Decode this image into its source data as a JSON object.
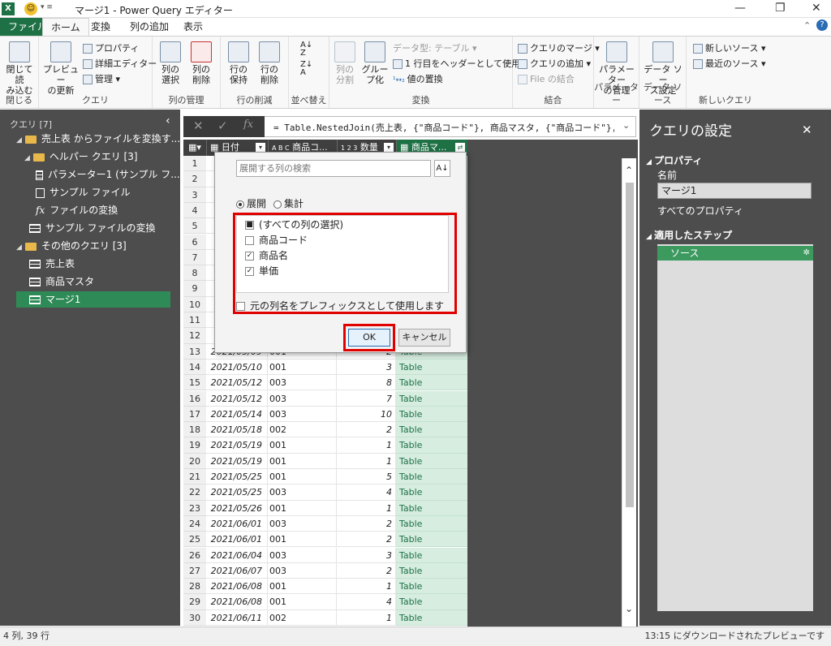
{
  "titlebar": {
    "title": "マージ1 - Power Query エディター",
    "app_icon": "X"
  },
  "tabs": [
    "ファイル",
    "ホーム",
    "変換",
    "列の追加",
    "表示"
  ],
  "ribbon": {
    "close": {
      "btn": "閉じて読\nみ込む",
      "label": "閉じる"
    },
    "query": {
      "preview": "プレビュー\nの更新",
      "properties": "プロパティ",
      "advanced": "詳細エディター",
      "manage": "管理",
      "label": "クエリ"
    },
    "columns": {
      "select": "列の\n選択",
      "remove": "列の\n削除",
      "label": "列の管理"
    },
    "rows": {
      "keep": "行の\n保持",
      "remove": "行の\n削除",
      "label": "行の削減"
    },
    "sort": {
      "label": "並べ替え"
    },
    "transform": {
      "split": "列の\n分割",
      "group": "グルー\nプ化",
      "datatype": "データ型: テーブル",
      "header": "1 行目をヘッダーとして使用",
      "replace": "値の置換",
      "label": "変換"
    },
    "combine": {
      "merge": "クエリのマージ",
      "append": "クエリの追加",
      "filecombine": "File の結合",
      "label": "結合"
    },
    "params": {
      "manage": "パラメーター\nの管理",
      "label": "パラメーター"
    },
    "datasource": {
      "settings": "データ ソー\nス設定",
      "label": "データ ソース"
    },
    "newquery": {
      "newsource": "新しいソース",
      "recent": "最近のソース",
      "label": "新しいクエリ"
    }
  },
  "queries": {
    "title": "クエリ [7]",
    "items": [
      {
        "label": "売上表 からファイルを変換す..."
      },
      {
        "label": "ヘルパー クエリ [3]"
      },
      {
        "label": "パラメーター1 (サンプル フ..."
      },
      {
        "label": "サンプル ファイル"
      },
      {
        "label": "ファイルの変換"
      },
      {
        "label": "サンプル ファイルの変換"
      },
      {
        "label": "その他のクエリ [3]"
      },
      {
        "label": "売上表"
      },
      {
        "label": "商品マスタ"
      },
      {
        "label": "マージ1"
      }
    ]
  },
  "formula": {
    "text": "= Table.NestedJoin(売上表, {\"商品コード\"}, 商品マスタ, {\"商品コード\"}, \"商品"
  },
  "grid": {
    "headers": [
      "日付",
      "商品コ...",
      "数量",
      "商品マ..."
    ],
    "header_types": [
      "",
      "A B C",
      "1 2 3",
      ""
    ],
    "rows": [
      {
        "n": "1"
      },
      {
        "n": "2"
      },
      {
        "n": "3"
      },
      {
        "n": "4"
      },
      {
        "n": "5"
      },
      {
        "n": "6"
      },
      {
        "n": "7"
      },
      {
        "n": "8"
      },
      {
        "n": "9"
      },
      {
        "n": "10"
      },
      {
        "n": "11"
      },
      {
        "n": "12"
      },
      {
        "n": "13",
        "date": "2021/05/09",
        "code": "001",
        "qty": "2",
        "tbl": "Table"
      },
      {
        "n": "14",
        "date": "2021/05/10",
        "code": "001",
        "qty": "3",
        "tbl": "Table"
      },
      {
        "n": "15",
        "date": "2021/05/12",
        "code": "003",
        "qty": "8",
        "tbl": "Table"
      },
      {
        "n": "16",
        "date": "2021/05/12",
        "code": "003",
        "qty": "7",
        "tbl": "Table"
      },
      {
        "n": "17",
        "date": "2021/05/14",
        "code": "003",
        "qty": "10",
        "tbl": "Table"
      },
      {
        "n": "18",
        "date": "2021/05/18",
        "code": "002",
        "qty": "2",
        "tbl": "Table"
      },
      {
        "n": "19",
        "date": "2021/05/19",
        "code": "001",
        "qty": "1",
        "tbl": "Table"
      },
      {
        "n": "20",
        "date": "2021/05/19",
        "code": "001",
        "qty": "1",
        "tbl": "Table"
      },
      {
        "n": "21",
        "date": "2021/05/25",
        "code": "001",
        "qty": "5",
        "tbl": "Table"
      },
      {
        "n": "22",
        "date": "2021/05/25",
        "code": "003",
        "qty": "4",
        "tbl": "Table"
      },
      {
        "n": "23",
        "date": "2021/05/26",
        "code": "001",
        "qty": "1",
        "tbl": "Table"
      },
      {
        "n": "24",
        "date": "2021/06/01",
        "code": "003",
        "qty": "2",
        "tbl": "Table"
      },
      {
        "n": "25",
        "date": "2021/06/01",
        "code": "001",
        "qty": "2",
        "tbl": "Table"
      },
      {
        "n": "26",
        "date": "2021/06/04",
        "code": "003",
        "qty": "3",
        "tbl": "Table"
      },
      {
        "n": "27",
        "date": "2021/06/07",
        "code": "003",
        "qty": "2",
        "tbl": "Table"
      },
      {
        "n": "28",
        "date": "2021/06/08",
        "code": "001",
        "qty": "1",
        "tbl": "Table"
      },
      {
        "n": "29",
        "date": "2021/06/08",
        "code": "001",
        "qty": "4",
        "tbl": "Table"
      },
      {
        "n": "30",
        "date": "2021/06/11",
        "code": "002",
        "qty": "1",
        "tbl": "Table"
      }
    ]
  },
  "dialog": {
    "search_placeholder": "展開する列の検索",
    "expand": "展開",
    "aggregate": "集計",
    "options": [
      {
        "label": "(すべての列の選択)",
        "state": "partial"
      },
      {
        "label": "商品コード",
        "state": "off"
      },
      {
        "label": "商品名",
        "state": "on"
      },
      {
        "label": "単価",
        "state": "on"
      }
    ],
    "prefix": "元の列名をプレフィックスとして使用します",
    "ok": "OK",
    "cancel": "キャンセル"
  },
  "settings": {
    "title": "クエリの設定",
    "properties": "プロパティ",
    "name_label": "名前",
    "name_value": "マージ1",
    "all_props": "すべてのプロパティ",
    "steps_label": "適用したステップ",
    "steps": [
      "ソース"
    ]
  },
  "status": {
    "left": "4 列, 39 行",
    "right": "13:15 にダウンロードされたプレビューです"
  },
  "colors": {
    "excel_green": "#1e7145",
    "highlight": "#e00000",
    "pane": "#4d4d4d"
  }
}
